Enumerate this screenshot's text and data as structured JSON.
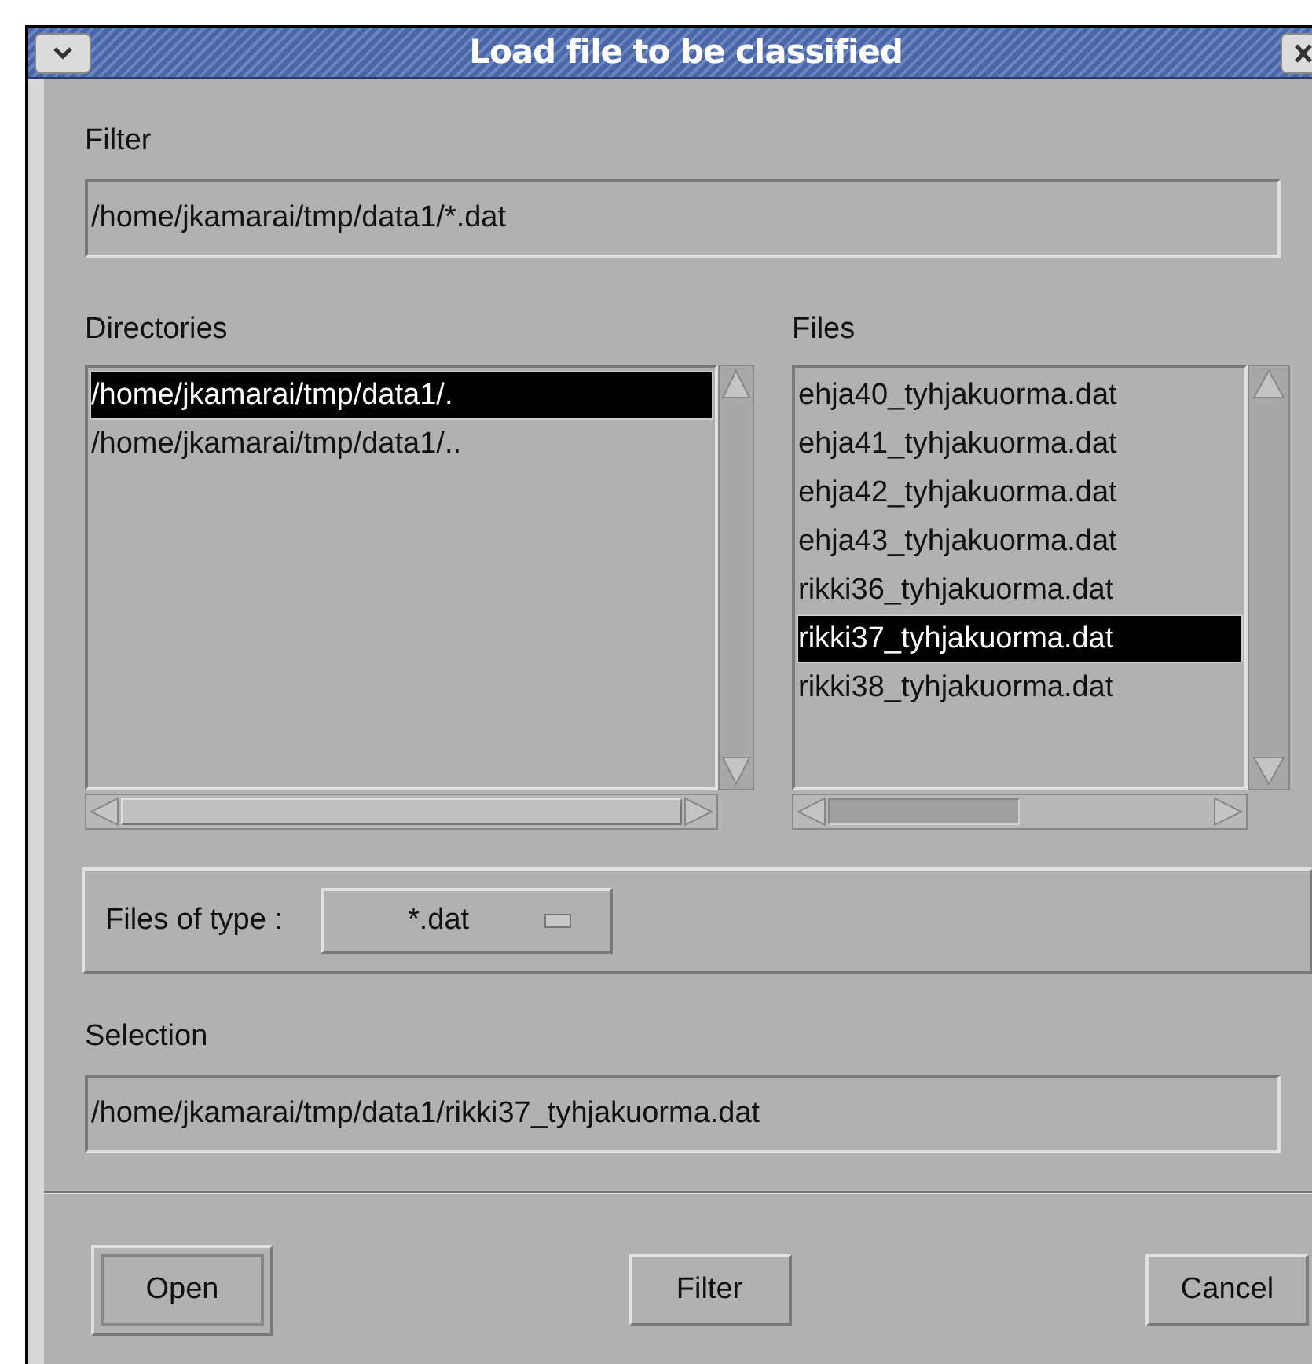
{
  "window": {
    "title": "Load file to be classified"
  },
  "filter": {
    "label": "Filter",
    "value": "/home/jkamarai/tmp/data1/*.dat"
  },
  "directories": {
    "label": "Directories",
    "items": [
      {
        "text": "/home/jkamarai/tmp/data1/.",
        "selected": true
      },
      {
        "text": "/home/jkamarai/tmp/data1/..",
        "selected": false
      }
    ]
  },
  "files": {
    "label": "Files",
    "items": [
      {
        "text": "ehja40_tyhjakuorma.dat",
        "selected": false
      },
      {
        "text": "ehja41_tyhjakuorma.dat",
        "selected": false
      },
      {
        "text": "ehja42_tyhjakuorma.dat",
        "selected": false
      },
      {
        "text": "ehja43_tyhjakuorma.dat",
        "selected": false
      },
      {
        "text": "rikki36_tyhjakuorma.dat",
        "selected": false
      },
      {
        "text": "rikki37_tyhjakuorma.dat",
        "selected": true
      },
      {
        "text": "rikki38_tyhjakuorma.dat",
        "selected": false
      }
    ]
  },
  "file_type": {
    "label": "Files of type :",
    "value": "*.dat"
  },
  "selection": {
    "label": "Selection",
    "value": "/home/jkamarai/tmp/data1/rikki37_tyhjakuorma.dat"
  },
  "buttons": [
    {
      "label": "Open",
      "default": true
    },
    {
      "label": "Filter",
      "default": false
    },
    {
      "label": "Cancel",
      "default": false
    }
  ]
}
